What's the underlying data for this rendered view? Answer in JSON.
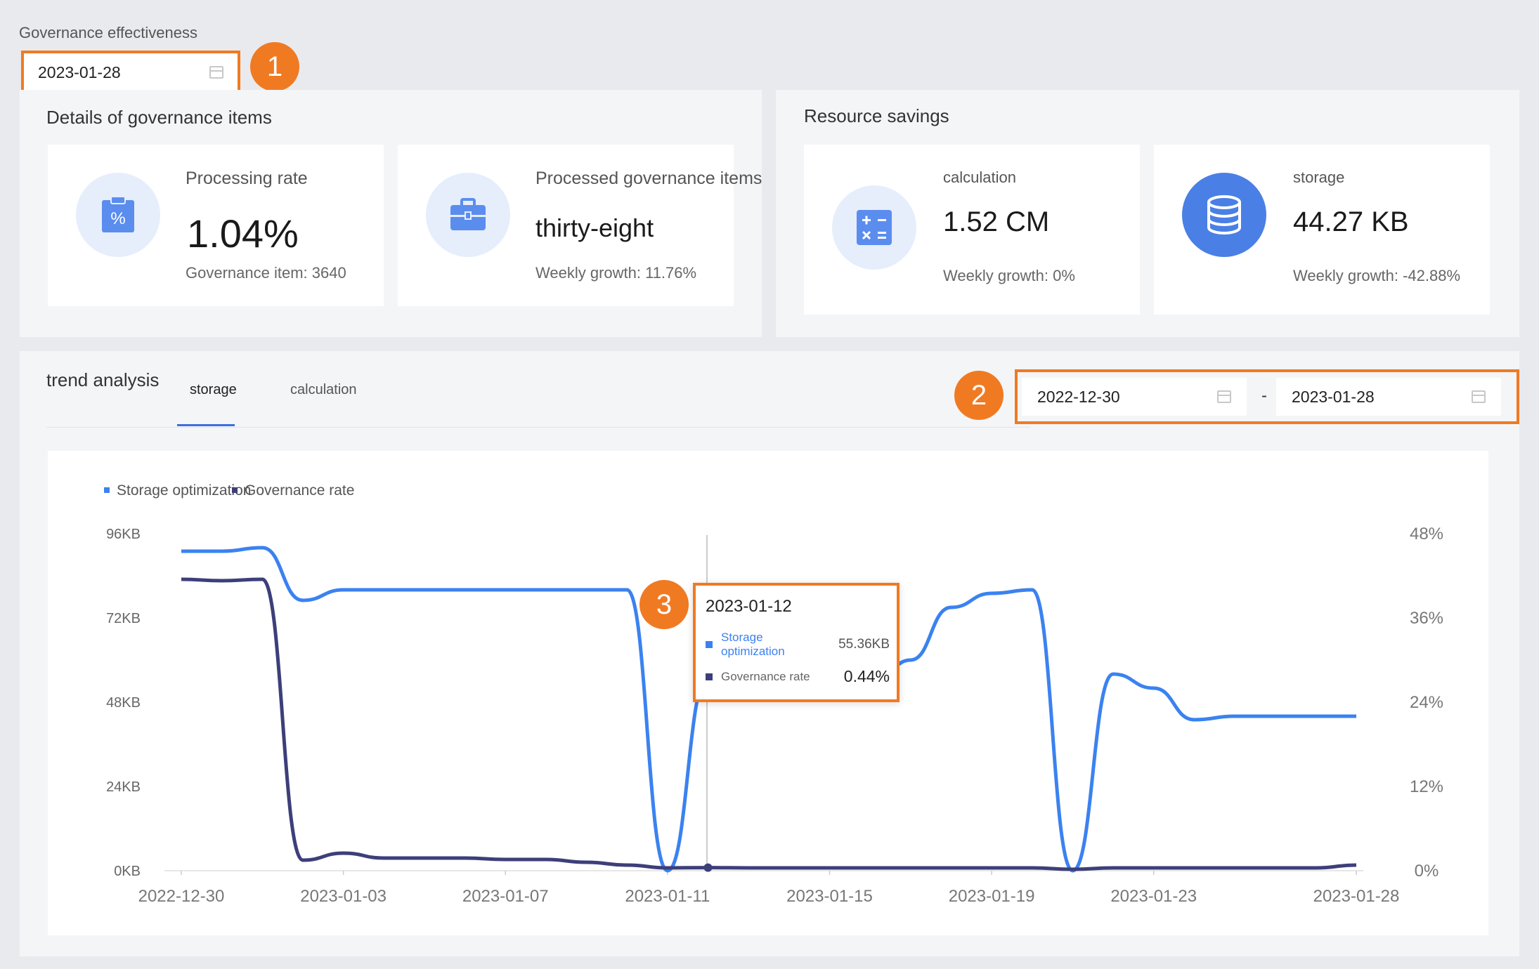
{
  "page": {
    "title": "Governance effectiveness",
    "date": "2023-01-28"
  },
  "badges": [
    "1",
    "2",
    "3"
  ],
  "details": {
    "title": "Details of governance items",
    "cards": [
      {
        "label": "Processing rate",
        "value": "1.04%",
        "sub": "Governance item: 3640",
        "icon": "clipboard-percent-icon"
      },
      {
        "label": "Processed governance items",
        "value": "thirty-eight",
        "sub": "Weekly growth: 11.76%",
        "icon": "briefcase-icon"
      }
    ]
  },
  "savings": {
    "title": "Resource savings",
    "cards": [
      {
        "label": "calculation",
        "value": "1.52 CM",
        "sub": "Weekly growth: 0%",
        "icon": "calculator-icon"
      },
      {
        "label": "storage",
        "value": "44.27 KB",
        "sub": "Weekly growth: -42.88%",
        "icon": "database-icon"
      }
    ]
  },
  "trend": {
    "title": "trend analysis",
    "tabs": [
      "storage",
      "calculation"
    ],
    "range_start": "2022-12-30",
    "range_sep": "-",
    "range_end": "2023-01-28"
  },
  "tooltip": {
    "date": "2023-01-12",
    "rows": [
      {
        "name": "Storage optimization",
        "value": "55.36KB"
      },
      {
        "name": "Governance rate",
        "value": "0.44%"
      }
    ]
  },
  "colors": {
    "accent": "#f07a22",
    "storage_line": "#3b82f0",
    "rate_line": "#3d3f7a"
  },
  "chart_data": {
    "type": "line",
    "legend": [
      "Storage optimization",
      "Governance rate"
    ],
    "x_ticks": [
      "2022-12-30",
      "2023-01-03",
      "2023-01-07",
      "2023-01-11",
      "2023-01-15",
      "2023-01-19",
      "2023-01-23",
      "2023-01-28"
    ],
    "y_left_ticks": [
      "0KB",
      "24KB",
      "48KB",
      "72KB",
      "96KB"
    ],
    "y_right_ticks": [
      "0%",
      "12%",
      "24%",
      "36%",
      "48%"
    ],
    "y_left_range": [
      0,
      96
    ],
    "y_right_range": [
      0,
      48
    ],
    "x": [
      "2022-12-30",
      "2022-12-31",
      "2023-01-01",
      "2023-01-02",
      "2023-01-03",
      "2023-01-04",
      "2023-01-05",
      "2023-01-06",
      "2023-01-07",
      "2023-01-08",
      "2023-01-09",
      "2023-01-10",
      "2023-01-11",
      "2023-01-12",
      "2023-01-13",
      "2023-01-14",
      "2023-01-15",
      "2023-01-16",
      "2023-01-17",
      "2023-01-18",
      "2023-01-19",
      "2023-01-20",
      "2023-01-21",
      "2023-01-22",
      "2023-01-23",
      "2023-01-24",
      "2023-01-25",
      "2023-01-26",
      "2023-01-27",
      "2023-01-28"
    ],
    "series": [
      {
        "name": "Storage optimization",
        "axis": "left",
        "values": [
          91,
          91,
          92,
          77,
          80,
          80,
          80,
          80,
          80,
          80,
          80,
          80,
          0,
          55.36,
          59,
          56,
          54,
          52,
          60,
          75,
          79,
          80,
          0,
          56,
          52,
          43,
          44,
          44,
          44,
          44
        ]
      },
      {
        "name": "Governance rate",
        "axis": "right",
        "values": [
          41.5,
          41.3,
          41.5,
          1.5,
          2.5,
          1.8,
          1.8,
          1.8,
          1.6,
          1.6,
          1.2,
          0.8,
          0.4,
          0.44,
          0.4,
          0.4,
          0.4,
          0.4,
          0.4,
          0.4,
          0.4,
          0.4,
          0.2,
          0.4,
          0.4,
          0.4,
          0.4,
          0.4,
          0.4,
          0.8
        ]
      }
    ]
  }
}
